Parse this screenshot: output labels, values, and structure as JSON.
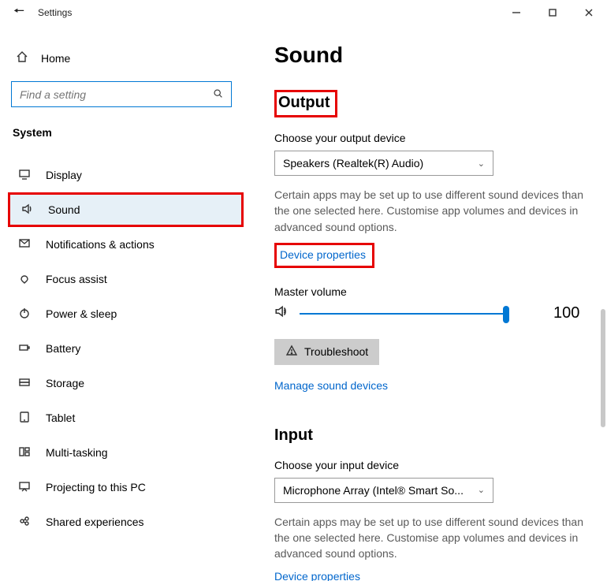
{
  "titlebar": {
    "app_title": "Settings"
  },
  "sidebar": {
    "home_label": "Home",
    "search_placeholder": "Find a setting",
    "category_label": "System",
    "items": [
      {
        "label": "Display"
      },
      {
        "label": "Sound"
      },
      {
        "label": "Notifications & actions"
      },
      {
        "label": "Focus assist"
      },
      {
        "label": "Power & sleep"
      },
      {
        "label": "Battery"
      },
      {
        "label": "Storage"
      },
      {
        "label": "Tablet"
      },
      {
        "label": "Multi-tasking"
      },
      {
        "label": "Projecting to this PC"
      },
      {
        "label": "Shared experiences"
      }
    ]
  },
  "main": {
    "page_title": "Sound",
    "output": {
      "heading": "Output",
      "choose_label": "Choose your output device",
      "selected_device": "Speakers (Realtek(R) Audio)",
      "description": "Certain apps may be set up to use different sound devices than the one selected here. Customise app volumes and devices in advanced sound options.",
      "device_properties_link": "Device properties",
      "master_volume_label": "Master volume",
      "master_volume_value": "100",
      "troubleshoot_label": "Troubleshoot",
      "manage_devices_link": "Manage sound devices"
    },
    "input": {
      "heading": "Input",
      "choose_label": "Choose your input device",
      "selected_device": "Microphone Array (Intel® Smart So...",
      "description": "Certain apps may be set up to use different sound devices than the one selected here. Customise app volumes and devices in advanced sound options.",
      "device_properties_link": "Device properties"
    }
  }
}
